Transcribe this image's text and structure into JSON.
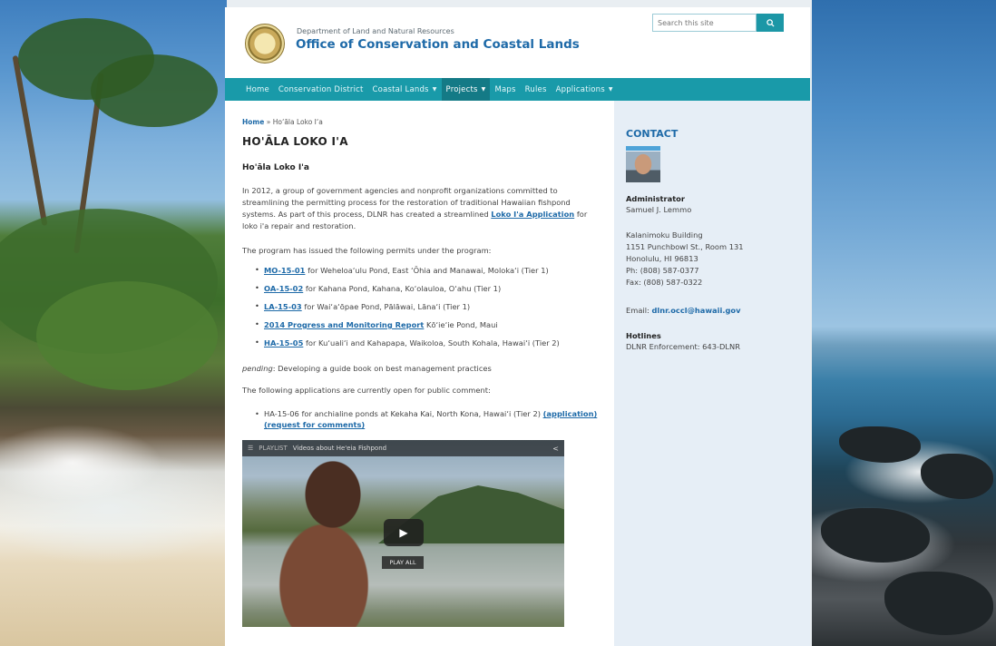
{
  "header": {
    "agency_sub": "Department of Land and Natural Resources",
    "agency_title": "Office of Conservation and Coastal Lands",
    "search_placeholder": "Search this site"
  },
  "nav": {
    "items": [
      {
        "label": "Home",
        "dropdown": false,
        "active": false
      },
      {
        "label": "Conservation District",
        "dropdown": false,
        "active": false
      },
      {
        "label": "Coastal Lands",
        "dropdown": true,
        "active": false
      },
      {
        "label": "Projects",
        "dropdown": true,
        "active": true
      },
      {
        "label": "Maps",
        "dropdown": false,
        "active": false
      },
      {
        "label": "Rules",
        "dropdown": false,
        "active": false
      },
      {
        "label": "Applications",
        "dropdown": true,
        "active": false
      }
    ]
  },
  "breadcrumb": {
    "home": "Home",
    "sep": "»",
    "current": "Ho‘āla Loko I‘a"
  },
  "main": {
    "title": "HO'ĀLA LOKO I'A",
    "sub_heading": "Ho'āla Loko I'a",
    "intro_pre": "In 2012, a group of government agencies and nonprofit organizations committed to streamlining the permitting process for the restoration of traditional Hawaiian fishpond systems. As part of this process, DLNR has created a streamlined ",
    "intro_link": "Loko I'a Application",
    "intro_post": " for loko i'a repair and restoration.",
    "permits_lead": "The program has issued the following permits under the program:",
    "permits": [
      {
        "link": "MO-15-01",
        "text": " for Weheloa‘ulu Pond, East ‘Ōhia and Manawai, Moloka‘i (Tier 1)"
      },
      {
        "link": "OA-15-02",
        "text": " for Kahana Pond, Kahana, Ko‘olauloa, O‘ahu (Tier 1)"
      },
      {
        "link": "LA-15-03",
        "text": " for Wai‘a‘ōpae Pond, Pālāwai, Lāna‘i (Tier 1)"
      },
      {
        "link": "2014 Progress and Monitoring Report",
        "text": " Kō‘ie‘ie Pond, Maui"
      },
      {
        "link": "HA-15-05",
        "text": " for Ku‘uali‘i and Kahapapa, Waikoloa, South Kohala, Hawai‘i (Tier 2)"
      }
    ],
    "pending_label": "pending",
    "pending_text": ": Developing a guide book on best management practices",
    "open_lead": "The following applications are currently open for public comment:",
    "apps": [
      {
        "text": "HA-15-06 for anchialine ponds at Kekaha Kai, North Kona, Hawai‘i (Tier 2) ",
        "link1": "(application)",
        "link2": "(request for comments)"
      }
    ]
  },
  "video": {
    "playlist_label": "PLAYLIST",
    "title": "Videos about He'eia Fishpond",
    "play_all": "PLAY ALL"
  },
  "sidebar": {
    "heading": "CONTACT",
    "role": "Administrator",
    "name": "Samuel J. Lemmo",
    "address": [
      "Kalanimoku Building",
      "1151 Punchbowl St., Room 131",
      "Honolulu, HI 96813",
      "Ph: (808) 587-0377",
      "Fax: (808) 587-0322"
    ],
    "email_label": "Email: ",
    "email": "dlnr.occl@hawaii.gov",
    "hotlines_label": "Hotlines",
    "hotline_text": "DLNR Enforcement: 643-DLNR"
  },
  "colors": {
    "accent": "#199aa9",
    "link": "#1e6aa8",
    "nav_active": "#147a86"
  }
}
